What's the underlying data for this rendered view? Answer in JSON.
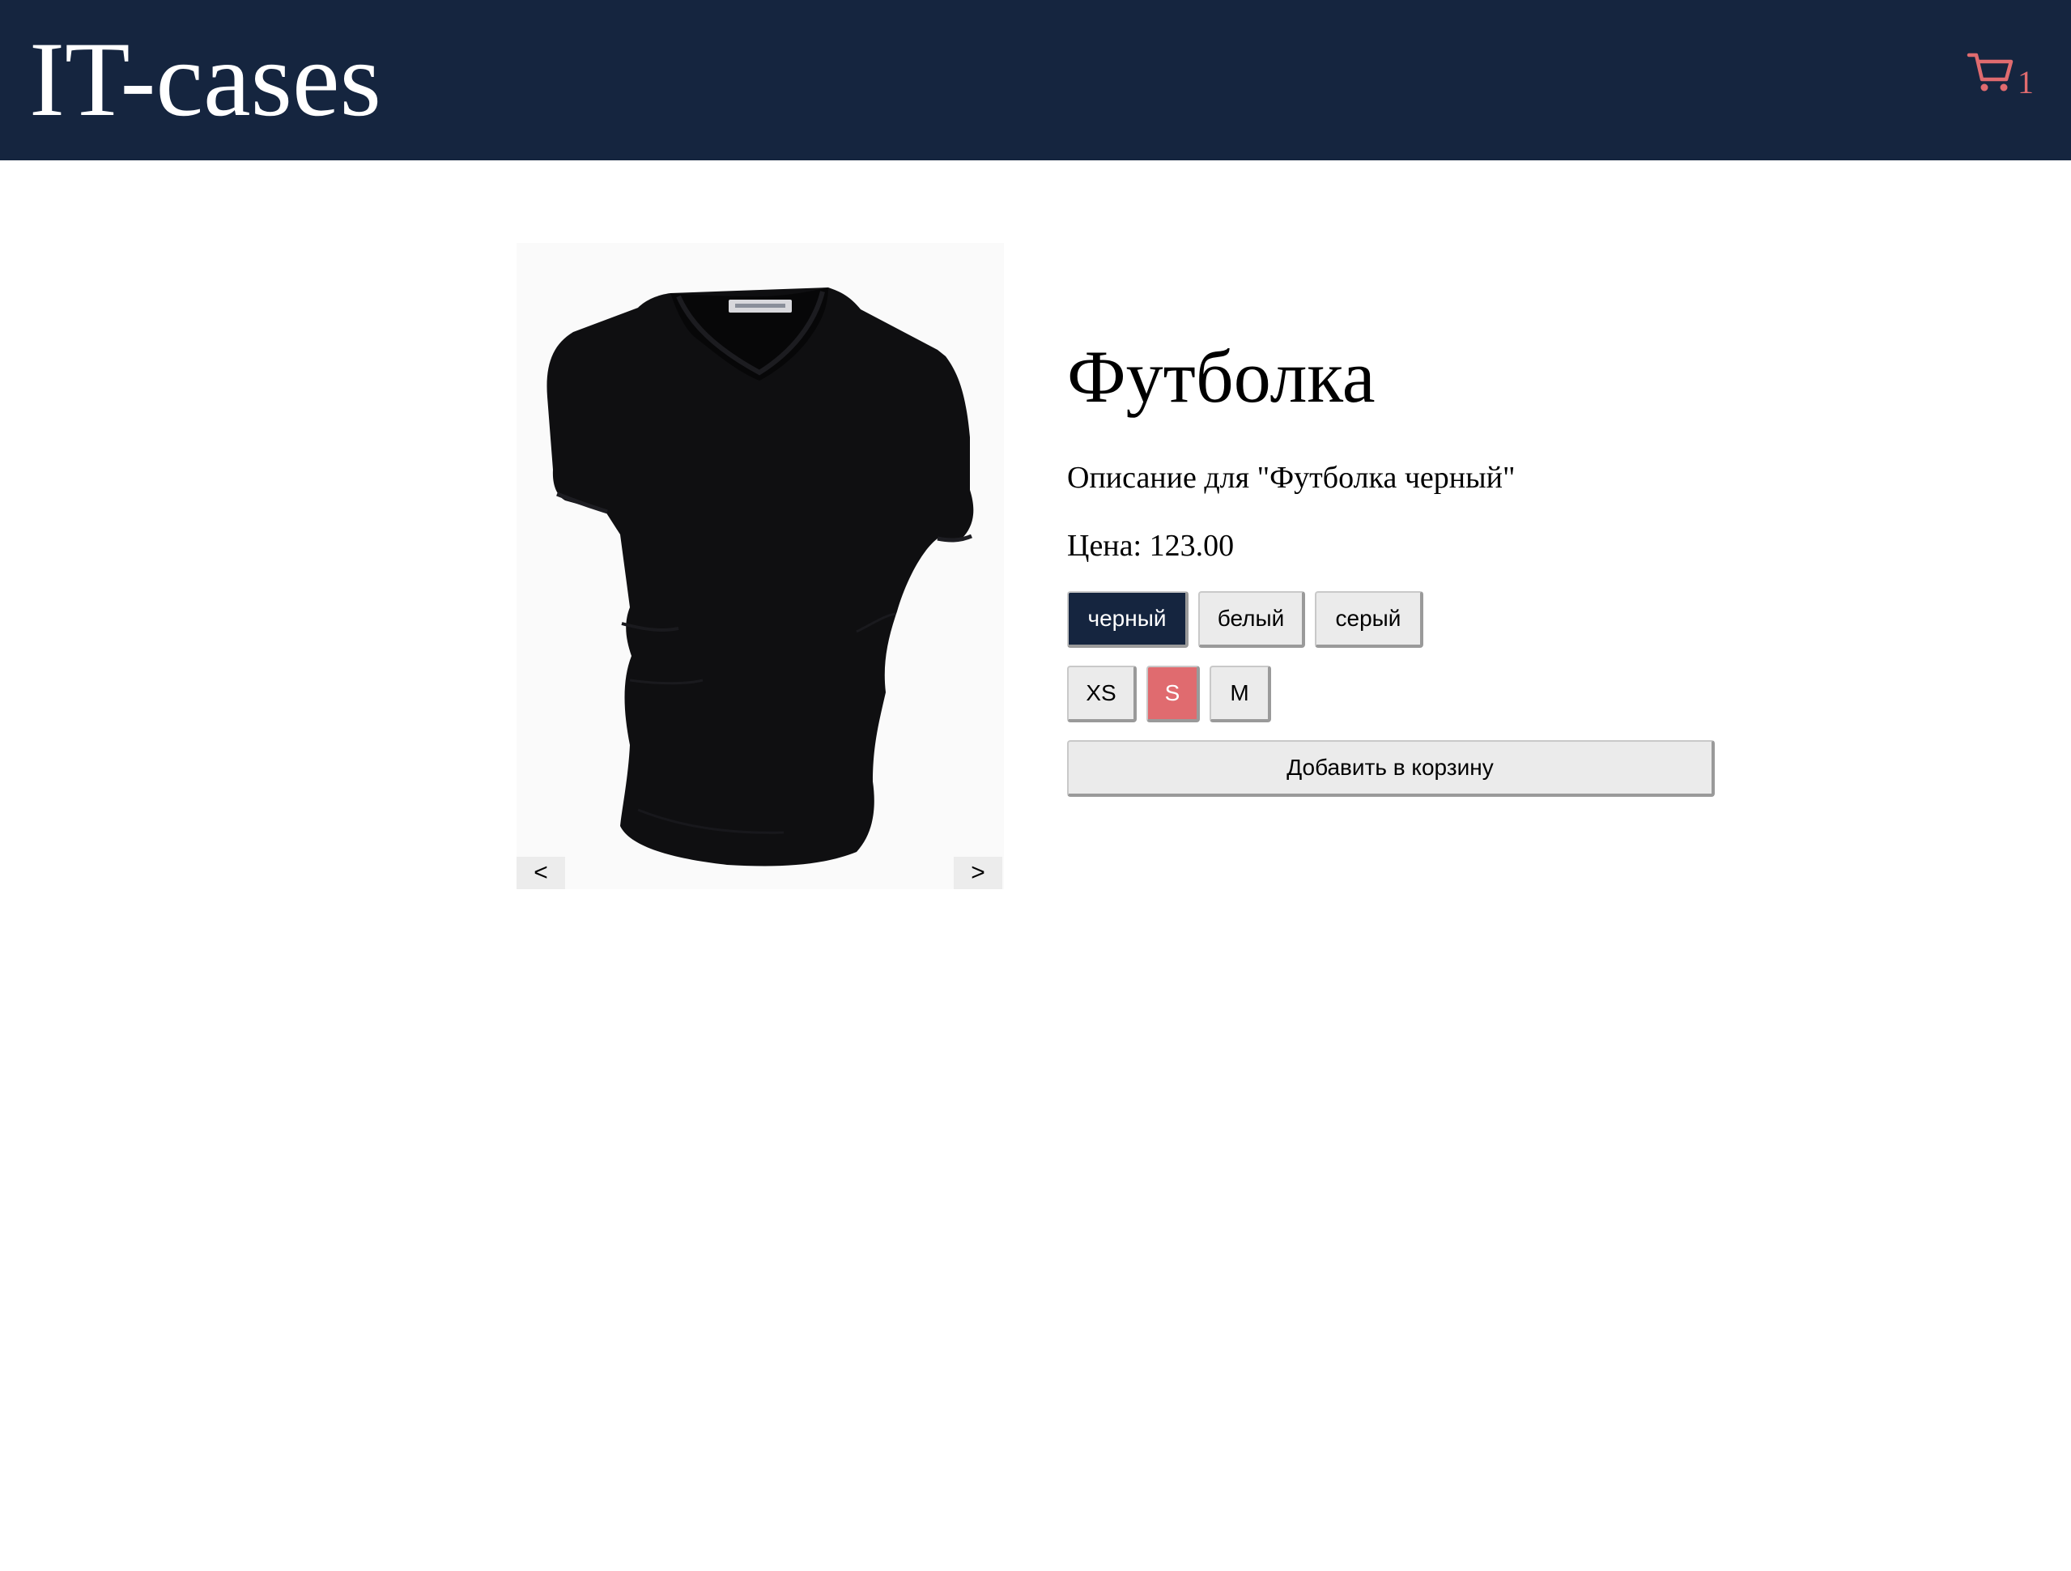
{
  "header": {
    "logo": "IT-cases",
    "cart_count": "1",
    "cart_icon": "cart-icon"
  },
  "colors": {
    "header_bg": "#15253f",
    "accent": "#e06b6f",
    "button_bg": "#ebebeb"
  },
  "gallery": {
    "image": "black v-neck t-shirt",
    "prev_label": "<",
    "next_label": ">"
  },
  "product": {
    "title": "Футболка",
    "description": "Описание для \"Футболка черный\"",
    "price": "Цена: 123.00",
    "color_options": [
      "черный",
      "белый",
      "серый"
    ],
    "selected_color": "черный",
    "size_options": [
      "XS",
      "S",
      "M"
    ],
    "selected_size": "S",
    "add_to_cart_label": "Добавить в корзину"
  }
}
